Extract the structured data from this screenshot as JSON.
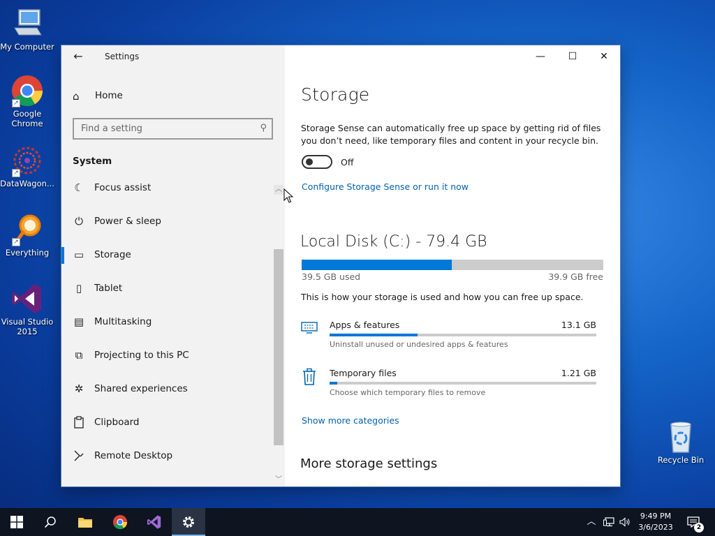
{
  "desktop": {
    "icons": [
      {
        "label": "My Computer",
        "icon": "computer-icon"
      },
      {
        "label": "Google Chrome",
        "icon": "chrome-icon"
      },
      {
        "label": "DataWagon...",
        "icon": "datawagon-icon"
      },
      {
        "label": "Everything",
        "icon": "everything-search-icon"
      },
      {
        "label": "Visual Studio 2015",
        "icon": "visual-studio-icon"
      },
      {
        "label": "Recycle Bin",
        "icon": "recycle-bin-icon"
      }
    ]
  },
  "window": {
    "app_title": "Settings",
    "back_icon": "←",
    "minimize": "—",
    "maximize": "☐",
    "close": "✕"
  },
  "sidebar": {
    "home_label": "Home",
    "search_placeholder": "Find a setting",
    "section": "System",
    "items": [
      {
        "label": "Focus assist",
        "icon": "☾"
      },
      {
        "label": "Power & sleep",
        "icon": "⏻"
      },
      {
        "label": "Storage",
        "icon": "▭",
        "selected": true
      },
      {
        "label": "Tablet",
        "icon": "▯"
      },
      {
        "label": "Multitasking",
        "icon": "▤"
      },
      {
        "label": "Projecting to this PC",
        "icon": "⧉"
      },
      {
        "label": "Shared experiences",
        "icon": "✲"
      },
      {
        "label": "Clipboard",
        "icon": "📋"
      },
      {
        "label": "Remote Desktop",
        "icon": "⟩⟨"
      }
    ]
  },
  "main": {
    "title": "Storage",
    "description": "Storage Sense can automatically free up space by getting rid of files you don’t need, like temporary files and content in your recycle bin.",
    "toggle_label": "Off",
    "configure_link": "Configure Storage Sense or run it now",
    "disk": {
      "title": "Local Disk (C:) - 79.4 GB",
      "used_label": "39.5 GB used",
      "free_label": "39.9 GB free",
      "used_fraction": 0.497
    },
    "usage_hint": "This is how your storage is used and how you can free up space.",
    "categories": [
      {
        "name": "Apps & features",
        "size": "13.1 GB",
        "sub": "Uninstall unused or undesired apps & features",
        "fraction": 0.33,
        "icon": "apps-features-icon"
      },
      {
        "name": "Temporary files",
        "size": "1.21 GB",
        "sub": "Choose which temporary files to remove",
        "fraction": 0.03,
        "icon": "trash-icon"
      }
    ],
    "show_more": "Show more categories",
    "more_settings": "More storage settings"
  },
  "taskbar": {
    "clock_time": "9:49 PM",
    "clock_date": "3/6/2023",
    "notification_count": "2"
  },
  "colors": {
    "accent": "#0078d7",
    "link": "#0063b1"
  }
}
